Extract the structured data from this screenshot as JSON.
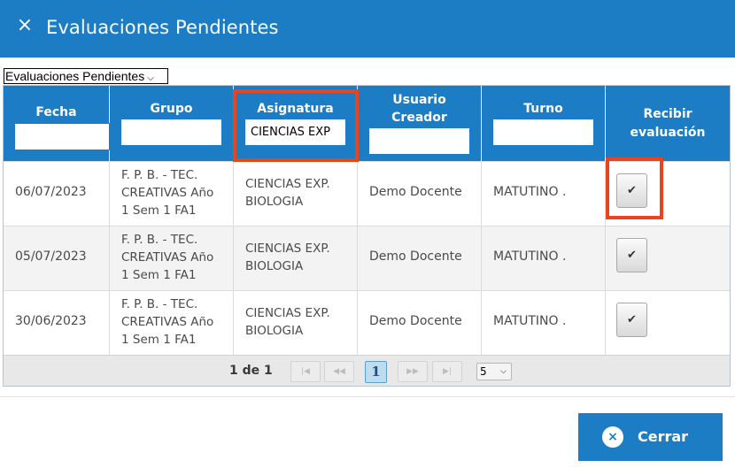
{
  "window": {
    "title": "Evaluaciones Pendientes",
    "close_glyph": "×"
  },
  "view_select": {
    "value": "Evaluaciones Pendientes"
  },
  "grid": {
    "columns": [
      {
        "key": "fecha",
        "label": "Fecha",
        "filter_value": ""
      },
      {
        "key": "grupo",
        "label": "Grupo",
        "filter_value": ""
      },
      {
        "key": "asignatura",
        "label": "Asignatura",
        "filter_value": "CIENCIAS EXP"
      },
      {
        "key": "usuario",
        "label": "Usuario Creador",
        "label_line1": "Usuario",
        "label_line2": "Creador",
        "filter_value": ""
      },
      {
        "key": "turno",
        "label": "Turno",
        "filter_value": ""
      },
      {
        "key": "recibir",
        "label": "Recibir evaluación",
        "label_line1": "Recibir",
        "label_line2": "evaluación"
      }
    ],
    "rows": [
      {
        "fecha": "06/07/2023",
        "grupo_l1": "F. P. B. - TEC.",
        "grupo_l2": "CREATIVAS Año",
        "grupo_l3": "1 Sem 1 FA1",
        "asig_l1": "CIENCIAS EXP.",
        "asig_l2": "BIOLOGIA",
        "usuario": "Demo Docente",
        "turno": "MATUTINO .",
        "check_glyph": "✔"
      },
      {
        "fecha": "05/07/2023",
        "grupo_l1": "F. P. B. - TEC.",
        "grupo_l2": "CREATIVAS Año",
        "grupo_l3": "1 Sem 1 FA1",
        "asig_l1": "CIENCIAS EXP.",
        "asig_l2": "BIOLOGIA",
        "usuario": "Demo Docente",
        "turno": "MATUTINO .",
        "check_glyph": "✔"
      },
      {
        "fecha": "30/06/2023",
        "grupo_l1": "F. P. B. - TEC.",
        "grupo_l2": "CREATIVAS Año",
        "grupo_l3": "1 Sem 1 FA1",
        "asig_l1": "CIENCIAS EXP.",
        "asig_l2": "BIOLOGIA",
        "usuario": "Demo Docente",
        "turno": "MATUTINO .",
        "check_glyph": "✔"
      }
    ]
  },
  "pager": {
    "info": "1 de 1",
    "current_page": "1",
    "page_size": "5",
    "icons": [
      "first-page-icon",
      "prev-page-icon",
      "next-page-icon",
      "last-page-icon"
    ]
  },
  "footer": {
    "close_label": "Cerrar",
    "close_icon": "×"
  },
  "colors": {
    "primary": "#1c7cc4",
    "highlight": "#e8451e",
    "row_alt": "#f3f3f3"
  }
}
